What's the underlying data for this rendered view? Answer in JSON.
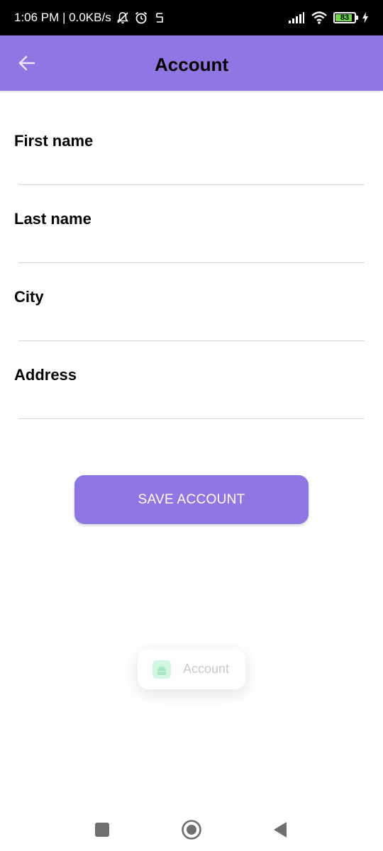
{
  "status_bar": {
    "time_network": "1:06 PM | 0.0KB/s",
    "battery_level": "83",
    "icons": [
      "mute-icon",
      "alarm-icon",
      "app-icon",
      "signal-icon",
      "wifi-icon",
      "battery-icon",
      "charging-icon"
    ]
  },
  "header": {
    "title": "Account",
    "back_icon": "arrow-left-icon",
    "background": "#8e77e2"
  },
  "form": {
    "fields": [
      {
        "label": "First name",
        "value": ""
      },
      {
        "label": "Last name",
        "value": ""
      },
      {
        "label": "City",
        "value": ""
      },
      {
        "label": "Address",
        "value": ""
      }
    ],
    "save_label": "SAVE ACCOUNT"
  },
  "toast": {
    "text": "Account",
    "icon": "android-app-icon"
  },
  "nav": {
    "icons": [
      "recents-icon",
      "home-icon",
      "back-triangle-icon"
    ]
  },
  "colors": {
    "accent": "#8e77e2",
    "status_bar": "#000000",
    "battery_fill": "#6bd64a"
  }
}
